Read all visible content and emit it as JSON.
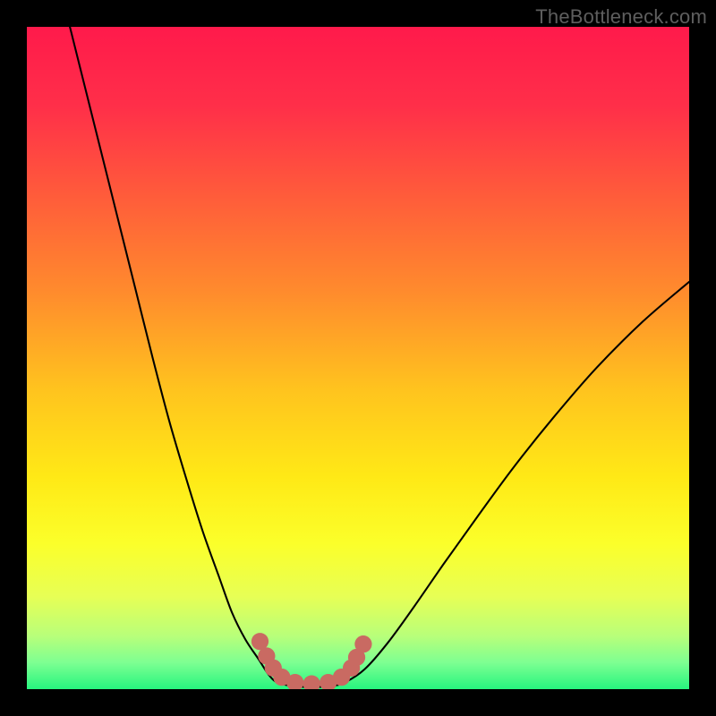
{
  "watermark": "TheBottleneck.com",
  "colors": {
    "frame": "#000000",
    "curve": "#000000",
    "marker": "#c96a62",
    "watermark": "#5e5e5e"
  },
  "chart_data": {
    "type": "line",
    "title": "",
    "xlabel": "",
    "ylabel": "",
    "xlim": [
      0,
      1
    ],
    "ylim": [
      0,
      1
    ],
    "gradient_stops": [
      {
        "offset": 0.0,
        "color": "#ff1a4b"
      },
      {
        "offset": 0.12,
        "color": "#ff2f49"
      },
      {
        "offset": 0.25,
        "color": "#ff5a3b"
      },
      {
        "offset": 0.4,
        "color": "#ff8b2d"
      },
      {
        "offset": 0.55,
        "color": "#ffc41e"
      },
      {
        "offset": 0.68,
        "color": "#ffe916"
      },
      {
        "offset": 0.78,
        "color": "#fbff2a"
      },
      {
        "offset": 0.86,
        "color": "#e7ff55"
      },
      {
        "offset": 0.92,
        "color": "#b8ff7a"
      },
      {
        "offset": 0.96,
        "color": "#7dff92"
      },
      {
        "offset": 1.0,
        "color": "#27f57e"
      }
    ],
    "series": [
      {
        "name": "left-branch",
        "x": [
          0.065,
          0.09,
          0.115,
          0.14,
          0.165,
          0.19,
          0.215,
          0.24,
          0.265,
          0.29,
          0.31,
          0.33,
          0.35,
          0.365,
          0.378
        ],
        "y": [
          1.0,
          0.9,
          0.8,
          0.7,
          0.6,
          0.5,
          0.405,
          0.32,
          0.24,
          0.17,
          0.115,
          0.075,
          0.045,
          0.022,
          0.01
        ]
      },
      {
        "name": "valley-floor",
        "x": [
          0.378,
          0.4,
          0.43,
          0.46,
          0.48
        ],
        "y": [
          0.01,
          0.005,
          0.003,
          0.005,
          0.01
        ]
      },
      {
        "name": "right-branch",
        "x": [
          0.48,
          0.51,
          0.545,
          0.585,
          0.63,
          0.68,
          0.735,
          0.795,
          0.86,
          0.93,
          1.0
        ],
        "y": [
          0.01,
          0.03,
          0.07,
          0.125,
          0.19,
          0.26,
          0.335,
          0.41,
          0.485,
          0.555,
          0.615
        ]
      }
    ],
    "markers": {
      "name": "highlight-dots",
      "x": [
        0.352,
        0.362,
        0.372,
        0.385,
        0.405,
        0.43,
        0.455,
        0.475,
        0.49,
        0.498,
        0.508
      ],
      "y": [
        0.072,
        0.05,
        0.032,
        0.018,
        0.01,
        0.008,
        0.01,
        0.018,
        0.032,
        0.048,
        0.068
      ],
      "r": 0.013
    }
  }
}
